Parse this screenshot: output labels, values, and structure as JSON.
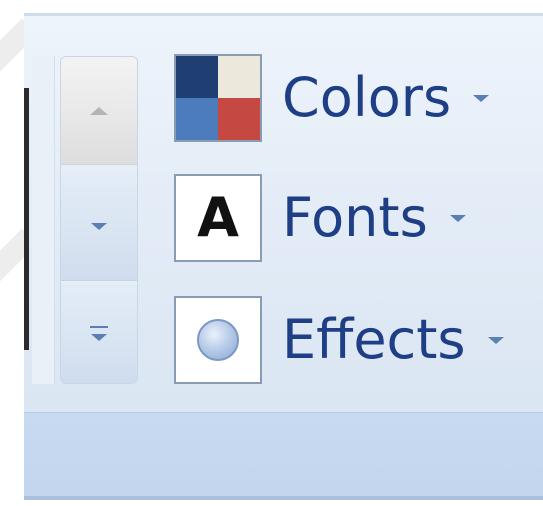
{
  "ribbon": {
    "gallery_scroll": {
      "up_icon": "triangle-up-icon",
      "down_icon": "triangle-down-icon",
      "more_icon": "gallery-more-icon"
    },
    "theme_options": {
      "colors": {
        "label": "Colors",
        "icon": "theme-colors-swatch-icon",
        "swatch": [
          "#1f3f72",
          "#ece8dc",
          "#4d7cbc",
          "#c64842"
        ]
      },
      "fonts": {
        "label": "Fonts",
        "icon": "theme-fonts-icon",
        "glyph": "A"
      },
      "effects": {
        "label": "Effects",
        "icon": "theme-effects-icon"
      }
    }
  },
  "colors": {
    "label_text": "#1e3e86",
    "dropdown_arrow": "#5a7fb0",
    "ribbon_background": "#e2ebf6",
    "ribbon_footer": "#c6d9ef"
  }
}
